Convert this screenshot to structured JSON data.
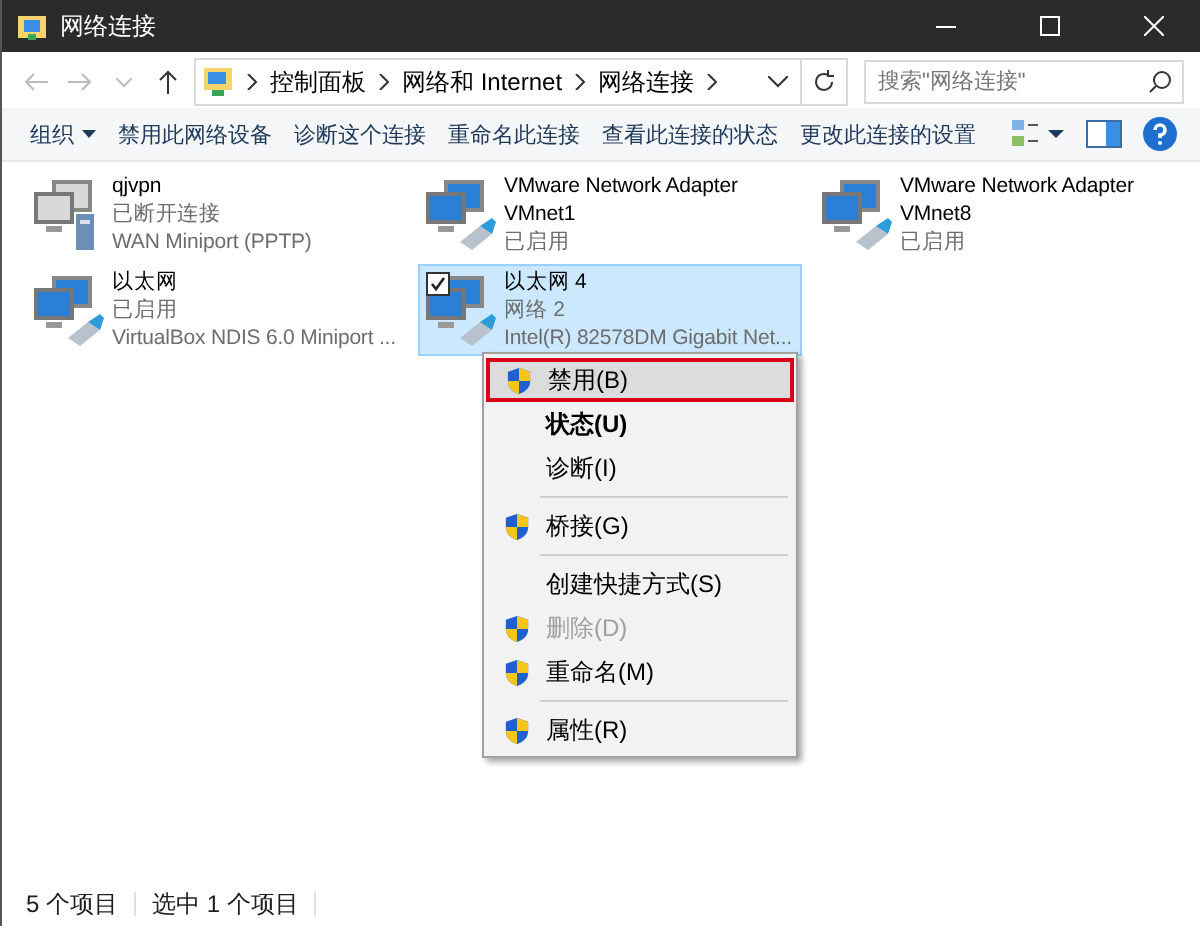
{
  "window": {
    "title": "网络连接"
  },
  "address": {
    "crumbs": [
      "控制面板",
      "网络和 Internet",
      "网络连接"
    ],
    "search_placeholder": "搜索\"网络连接\""
  },
  "commands": [
    "组织",
    "禁用此网络设备",
    "诊断这个连接",
    "重命名此连接",
    "查看此连接的状态",
    "更改此连接的设置"
  ],
  "connections": [
    {
      "kind": "vpn",
      "name": "qjvpn",
      "status": "已断开连接",
      "device": "WAN Miniport (PPTP)",
      "selected": false,
      "checked": false
    },
    {
      "kind": "ethernet",
      "name": "VMware Network Adapter\nVMnet1",
      "status": "已启用",
      "selected": false,
      "checked": false
    },
    {
      "kind": "ethernet",
      "name": "VMware Network Adapter\nVMnet8",
      "status": "已启用",
      "selected": false,
      "checked": false
    },
    {
      "kind": "ethernet",
      "name": "以太网",
      "status": "已启用",
      "device": "VirtualBox NDIS 6.0 Miniport ...",
      "selected": false,
      "checked": false
    },
    {
      "kind": "ethernet",
      "name": "以太网 4",
      "status": "网络  2",
      "device": "Intel(R) 82578DM Gigabit Net...",
      "selected": true,
      "checked": true
    }
  ],
  "context_menu": [
    {
      "kind": "item",
      "label": "禁用(B)",
      "shield": true,
      "bold": false,
      "disabled": false,
      "highlighted": true
    },
    {
      "kind": "item",
      "label": "状态(U)",
      "shield": false,
      "bold": true,
      "disabled": false,
      "highlighted": false
    },
    {
      "kind": "item",
      "label": "诊断(I)",
      "shield": false,
      "bold": false,
      "disabled": false,
      "highlighted": false
    },
    {
      "kind": "separator"
    },
    {
      "kind": "item",
      "label": "桥接(G)",
      "shield": true,
      "bold": false,
      "disabled": false,
      "highlighted": false
    },
    {
      "kind": "separator"
    },
    {
      "kind": "item",
      "label": "创建快捷方式(S)",
      "shield": false,
      "bold": false,
      "disabled": false,
      "highlighted": false
    },
    {
      "kind": "item",
      "label": "删除(D)",
      "shield": true,
      "bold": false,
      "disabled": true,
      "highlighted": false
    },
    {
      "kind": "item",
      "label": "重命名(M)",
      "shield": true,
      "bold": false,
      "disabled": false,
      "highlighted": false
    },
    {
      "kind": "separator"
    },
    {
      "kind": "item",
      "label": "属性(R)",
      "shield": true,
      "bold": false,
      "disabled": false,
      "highlighted": false
    }
  ],
  "status_bar": {
    "count": "5 个项目",
    "selection": "选中 1 个项目"
  }
}
